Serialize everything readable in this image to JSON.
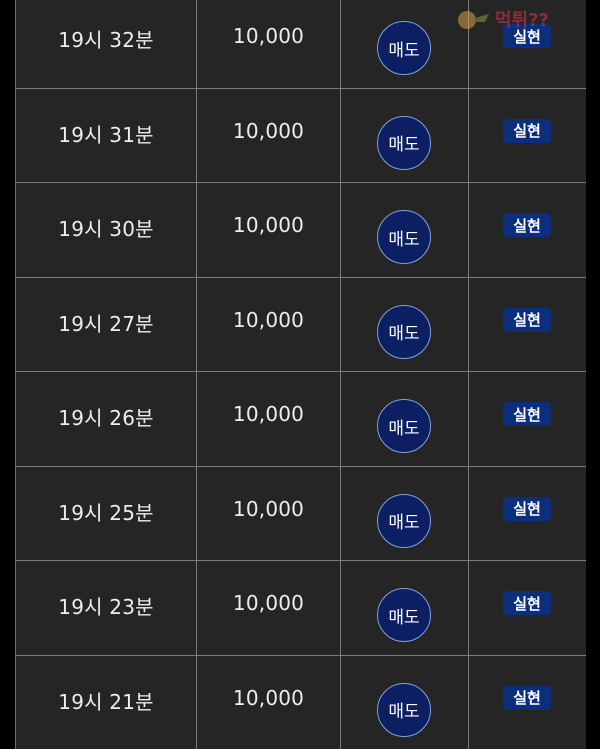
{
  "watermark": {
    "title": "먹튀??"
  },
  "rows": [
    {
      "time": "19시 32분",
      "amount": "10,000",
      "side": "매도",
      "status": "실현"
    },
    {
      "time": "19시 31분",
      "amount": "10,000",
      "side": "매도",
      "status": "실현"
    },
    {
      "time": "19시 30분",
      "amount": "10,000",
      "side": "매도",
      "status": "실현"
    },
    {
      "time": "19시 27분",
      "amount": "10,000",
      "side": "매도",
      "status": "실현"
    },
    {
      "time": "19시 26분",
      "amount": "10,000",
      "side": "매도",
      "status": "실현"
    },
    {
      "time": "19시 25분",
      "amount": "10,000",
      "side": "매도",
      "status": "실현"
    },
    {
      "time": "19시 23분",
      "amount": "10,000",
      "side": "매도",
      "status": "실현"
    },
    {
      "time": "19시 21분",
      "amount": "10,000",
      "side": "매도",
      "status": "실현"
    }
  ],
  "colors": {
    "cell_bg": "#252525",
    "grid": "#7a7a7a",
    "side_button": "#0c1f63",
    "status_badge": "#0b2f7c"
  }
}
